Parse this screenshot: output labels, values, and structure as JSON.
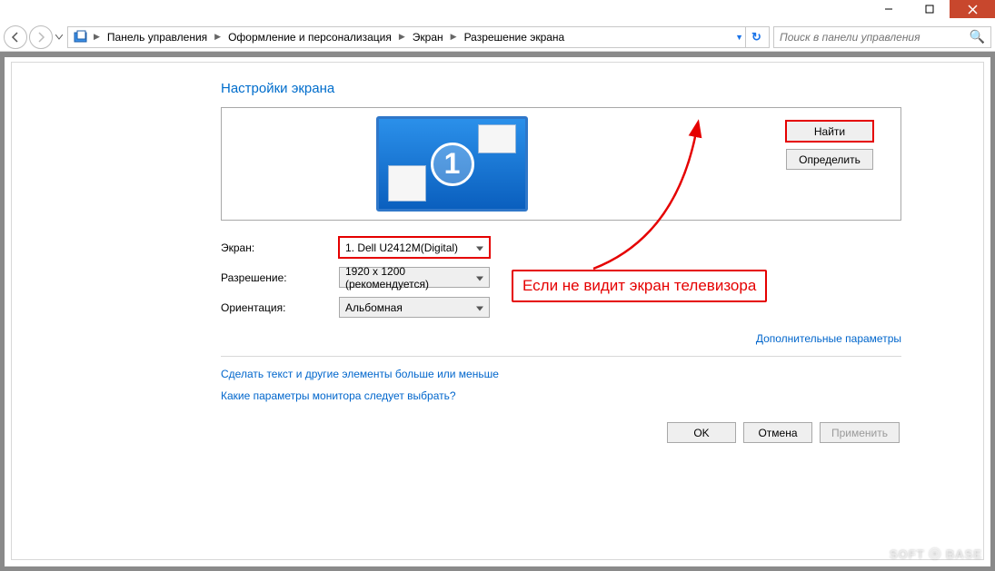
{
  "titlebar": {},
  "nav": {
    "crumbs": [
      "Панель управления",
      "Оформление и персонализация",
      "Экран",
      "Разрешение экрана"
    ],
    "search_placeholder": "Поиск в панели управления"
  },
  "page": {
    "title": "Настройки экрана",
    "monitor_number": "1",
    "buttons": {
      "detect": "Найти",
      "identify": "Определить"
    },
    "form": {
      "display_label": "Экран:",
      "display_value": "1. Dell U2412M(Digital)",
      "resolution_label": "Разрешение:",
      "resolution_value": "1920 x 1200 (рекомендуется)",
      "orientation_label": "Ориентация:",
      "orientation_value": "Альбомная"
    },
    "advanced_link": "Дополнительные параметры",
    "help_links": [
      "Сделать текст и другие элементы больше или меньше",
      "Какие параметры монитора следует выбрать?"
    ],
    "footer": {
      "ok": "OK",
      "cancel": "Отмена",
      "apply": "Применить"
    }
  },
  "annotation": {
    "text": "Если не видит экран телевизора"
  },
  "watermark": "SOFT ⦿ BASE"
}
